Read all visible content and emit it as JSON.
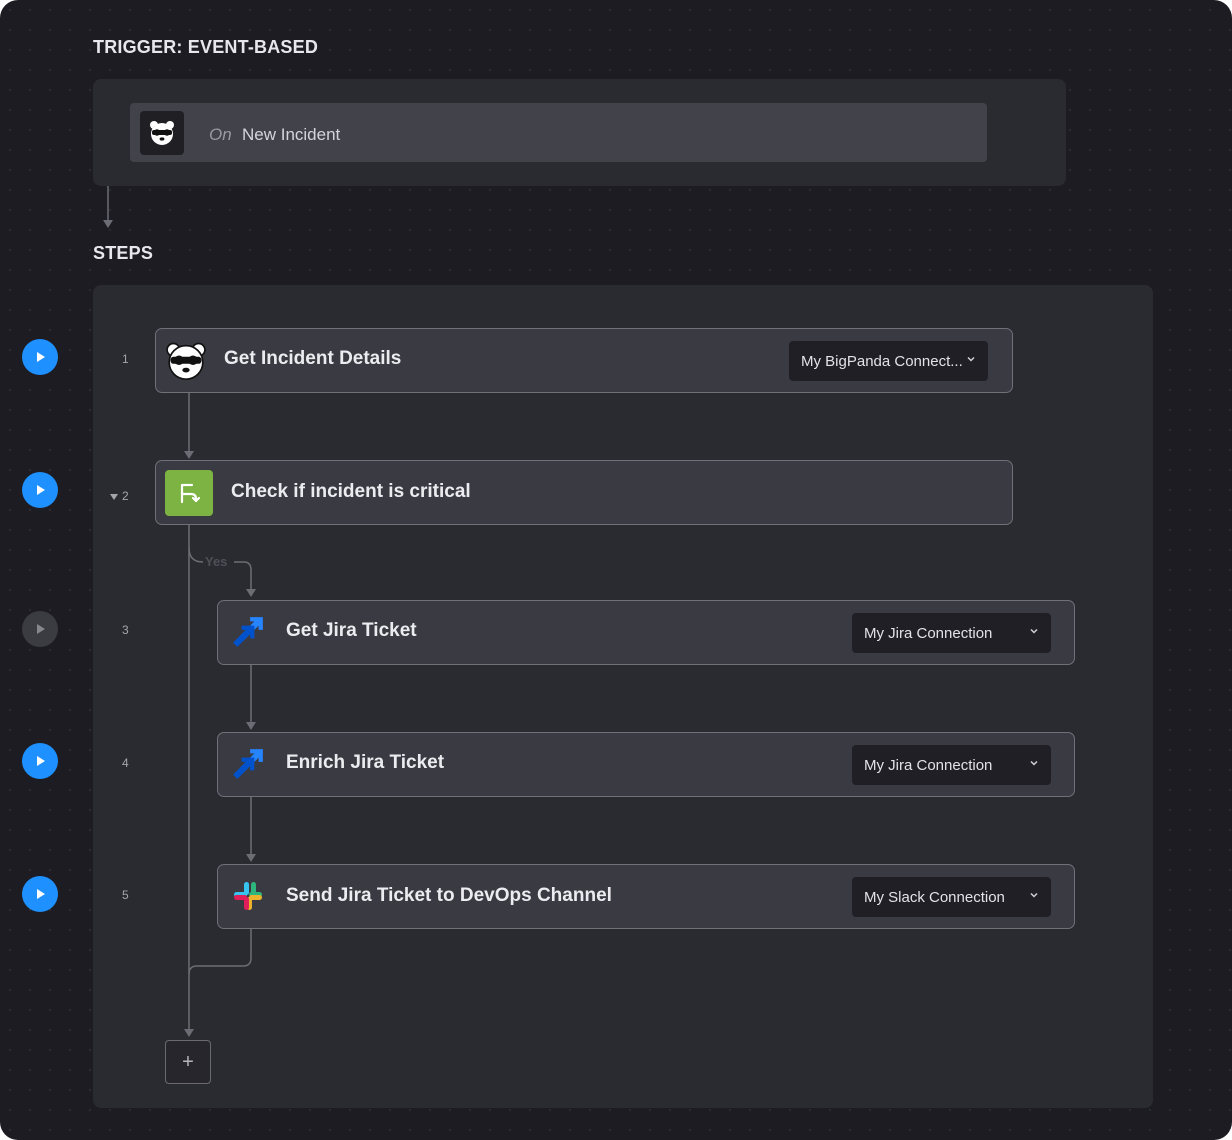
{
  "trigger": {
    "section_title": "TRIGGER: EVENT-BASED",
    "prefix": "On",
    "event_name": "New Incident",
    "icon": "bigpanda-icon"
  },
  "steps_section": {
    "title": "STEPS",
    "branch_label": "Yes",
    "add_label": "+"
  },
  "steps": [
    {
      "number": "1",
      "title": "Get Incident Details",
      "connection": "My BigPanda Connect...",
      "icon": "bigpanda-icon",
      "run_state": "active"
    },
    {
      "number": "2",
      "title": "Check if incident is critical",
      "connection": "",
      "icon": "branch-icon",
      "run_state": "active",
      "collapsible": true
    },
    {
      "number": "3",
      "title": "Get Jira Ticket",
      "connection": "My Jira Connection",
      "icon": "jira-icon",
      "run_state": "disabled"
    },
    {
      "number": "4",
      "title": "Enrich Jira Ticket",
      "connection": "My Jira Connection",
      "icon": "jira-icon",
      "run_state": "active"
    },
    {
      "number": "5",
      "title": "Send Jira Ticket to DevOps Channel",
      "connection": "My Slack Connection",
      "icon": "slack-icon",
      "run_state": "active"
    }
  ],
  "colors": {
    "play_active": "#1e90ff",
    "branch_green": "#7cb342",
    "jira_blue": "#2684ff"
  }
}
